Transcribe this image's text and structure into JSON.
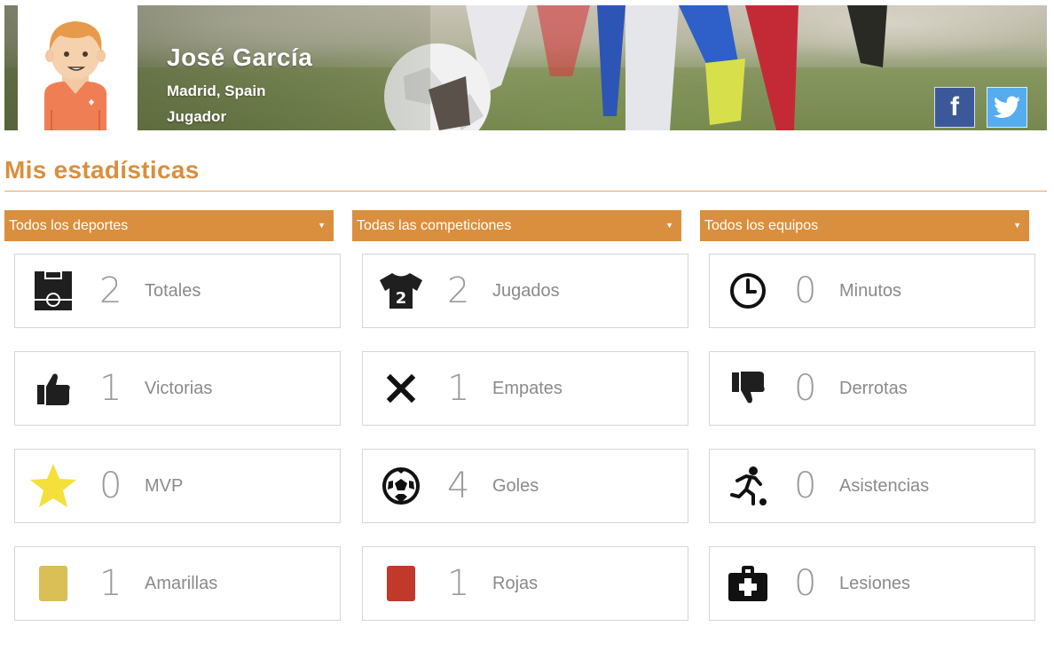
{
  "profile": {
    "name": "José García",
    "location": "Madrid, Spain",
    "role": "Jugador"
  },
  "social": {
    "facebook_icon": "facebook-icon",
    "twitter_icon": "twitter-icon"
  },
  "section": {
    "title": "Mis estadísticas"
  },
  "filters": [
    {
      "value": "Todos los deportes"
    },
    {
      "value": "Todas las competiciones"
    },
    {
      "value": "Todos los equipos"
    }
  ],
  "stats": [
    {
      "icon": "pitch-icon",
      "value": "2",
      "label": "Totales"
    },
    {
      "icon": "jersey-icon",
      "value": "2",
      "label": "Jugados"
    },
    {
      "icon": "clock-icon",
      "value": "0",
      "label": "Minutos"
    },
    {
      "icon": "thumbs-up-icon",
      "value": "1",
      "label": "Victorias"
    },
    {
      "icon": "x-icon",
      "value": "1",
      "label": "Empates"
    },
    {
      "icon": "thumbs-down-icon",
      "value": "0",
      "label": "Derrotas"
    },
    {
      "icon": "star-icon",
      "value": "0",
      "label": "MVP"
    },
    {
      "icon": "soccer-ball-icon",
      "value": "4",
      "label": "Goles"
    },
    {
      "icon": "kicker-icon",
      "value": "0",
      "label": "Asistencias"
    },
    {
      "icon": "yellow-card-icon",
      "value": "1",
      "label": "Amarillas"
    },
    {
      "icon": "red-card-icon",
      "value": "1",
      "label": "Rojas"
    },
    {
      "icon": "first-aid-icon",
      "value": "0",
      "label": "Lesiones"
    }
  ],
  "colors": {
    "accent": "#d98f3e",
    "yellow_card": "#d9bf55",
    "red_card": "#c0392b",
    "star": "#f5df3a"
  }
}
